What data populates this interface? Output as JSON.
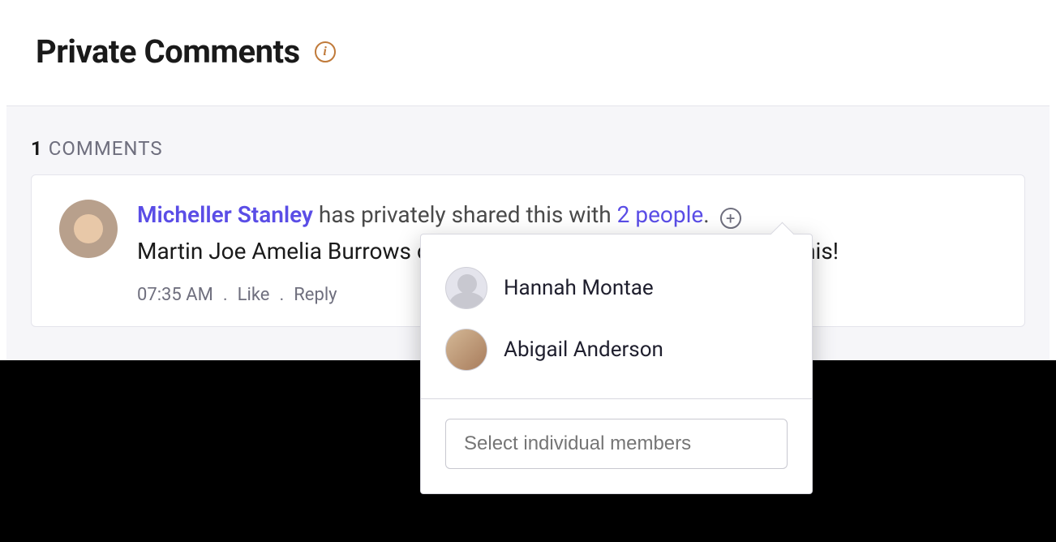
{
  "header": {
    "title": "Private Comments"
  },
  "panel": {
    "count_number": "1",
    "count_label": "COMMENTS"
  },
  "comment": {
    "author_name": "Micheller Stanley",
    "share_middle": " has privately shared this with ",
    "people_link": "2 people",
    "share_end": ".",
    "body_text": "Martin Joe Amelia Burrows could you guyz also get involved with this!",
    "time": "07:35 AM",
    "like_label": "Like",
    "reply_label": "Reply",
    "dot": "."
  },
  "popover": {
    "members": [
      {
        "name": "Hannah Montae",
        "avatar_kind": "silhouette"
      },
      {
        "name": "Abigail Anderson",
        "avatar_kind": "photo"
      }
    ],
    "select_placeholder": "Select individual members"
  }
}
